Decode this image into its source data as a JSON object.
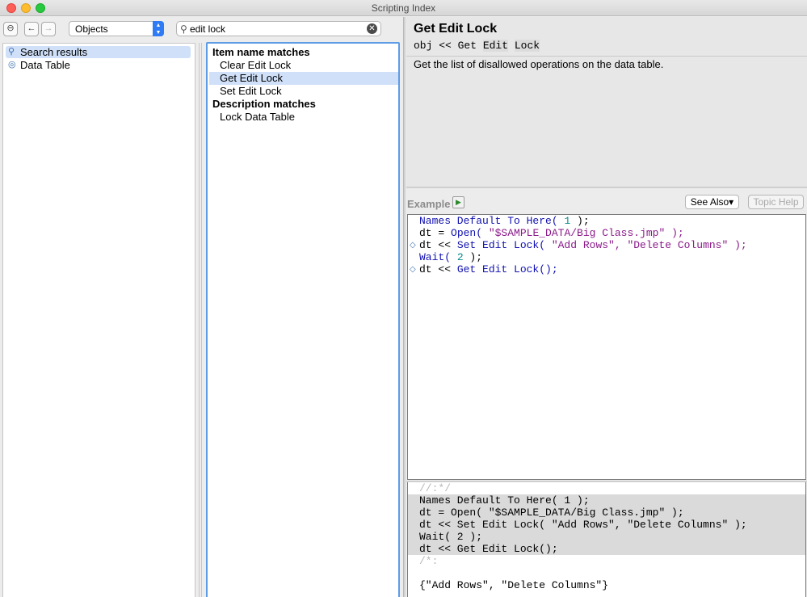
{
  "window": {
    "title": "Scripting Index"
  },
  "toolbar": {
    "collapse_glyph": "⊖",
    "back_glyph": "←",
    "forward_glyph": "→",
    "scope_select": {
      "value": "Objects"
    },
    "search": {
      "value": "edit lock",
      "icon": "magnifier-icon",
      "clear_glyph": "✕"
    }
  },
  "tree": {
    "items": [
      {
        "label": "Search results",
        "icon": "magnifier-icon",
        "glyph": "🔍",
        "selected": true
      },
      {
        "label": "Data Table",
        "icon": "object-icon",
        "glyph": "◎",
        "selected": false
      }
    ]
  },
  "results": {
    "sections": [
      {
        "heading": "Item name matches",
        "items": [
          "Clear Edit Lock",
          "Get Edit Lock",
          "Set Edit Lock"
        ],
        "selected_index": 1
      },
      {
        "heading": "Description matches",
        "items": [
          "Lock Data Table"
        ]
      }
    ]
  },
  "topic": {
    "title": "Get Edit Lock",
    "syntax_prefix": "obj << Get ",
    "syntax_word1": "Edit",
    "syntax_word2": "Lock",
    "description": "Get the list of disallowed operations on the data table."
  },
  "example": {
    "label": "Example",
    "run_glyph": "▶",
    "see_also_label": "See Also▾",
    "topic_help_label": "Topic Help",
    "code": [
      {
        "a": "Names Default To Here( ",
        "b": "1",
        "c": " );"
      },
      {
        "a": "dt = ",
        "b": "Open(",
        "c": " \"$SAMPLE_DATA/Big Class.jmp\" );"
      },
      {
        "a": "dt << ",
        "b": "Set Edit Lock(",
        "c": " \"Add Rows\", \"Delete Columns\" );"
      },
      {
        "a": "Wait( ",
        "b": "2",
        "c": " );"
      },
      {
        "a": "dt << ",
        "b": "Get Edit Lock();",
        "c": ""
      }
    ],
    "breakpoint_glyph": "◇"
  },
  "log": {
    "open_marker": "//:*/",
    "lines": [
      "Names Default To Here( 1 );",
      "dt = Open( \"$SAMPLE_DATA/Big Class.jmp\" );",
      "dt << Set Edit Lock( \"Add Rows\", \"Delete Columns\" );",
      "Wait( 2 );",
      "dt << Get Edit Lock();"
    ],
    "close_marker": "/*:",
    "result": "{\"Add Rows\", \"Delete Columns\"}"
  }
}
